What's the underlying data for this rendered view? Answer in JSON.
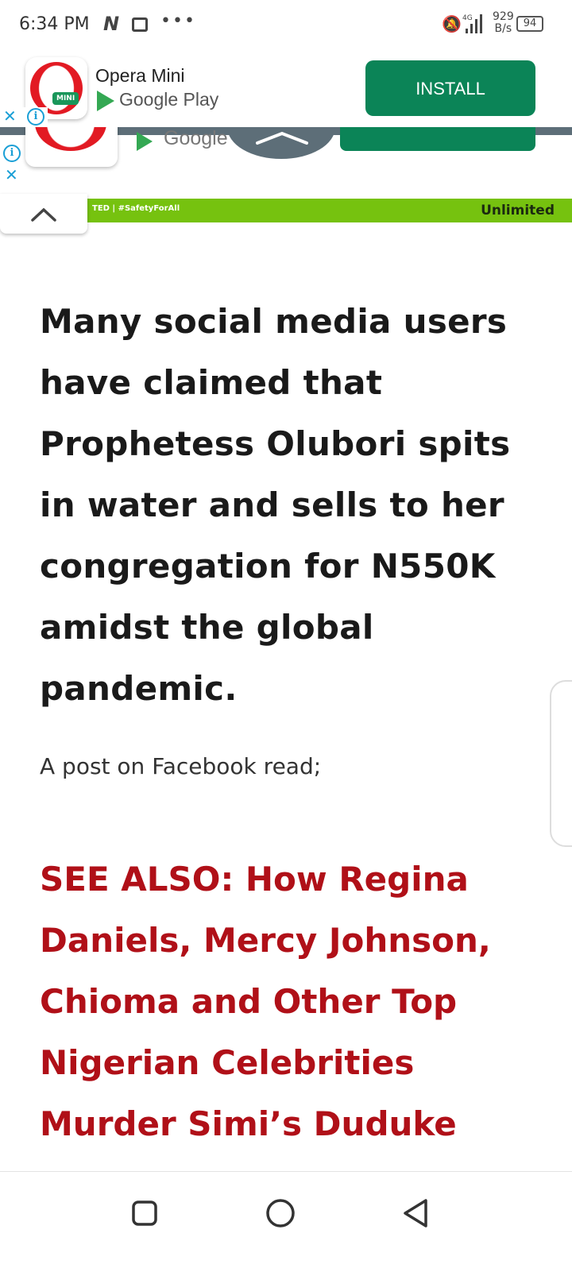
{
  "status_bar": {
    "time": "6:34 PM",
    "network_type": "4G",
    "speed_value": "929",
    "speed_unit": "B/s",
    "battery": "94"
  },
  "ad_banner": {
    "app_name": "Opera Mini",
    "badge_text": "MINI",
    "store_name": "Google Play",
    "install_label": "INSTALL"
  },
  "ad_banner_2": {
    "store_name": "Google"
  },
  "promo_strip": {
    "left_text": "TED | #SafetyForAll",
    "right_text": "Unlimited"
  },
  "article": {
    "headline": "Many social media users have claimed that Prophetess Olubori spits in water and sells to her congregation for N550K amidst the global pandemic.",
    "intro": "A post on Facebook read;",
    "see_also": "SEE ALSO: How Regina Daniels, Mercy Johnson, Chioma and Other Top Nigerian Celebrities Murder Simi’s Duduke Challenge (VIDEO)"
  },
  "colors": {
    "install_green": "#0b8457",
    "see_also_red": "#b01018",
    "strip_green": "#76c20f",
    "adchoices_blue": "#1a9fd6"
  },
  "icons": [
    "bell-off-icon",
    "signal-icon",
    "battery-icon",
    "adchoices-info-icon",
    "close-ad-icon",
    "google-play-icon",
    "chevron-up-icon",
    "nav-recent-icon",
    "nav-home-icon",
    "nav-back-icon"
  ]
}
